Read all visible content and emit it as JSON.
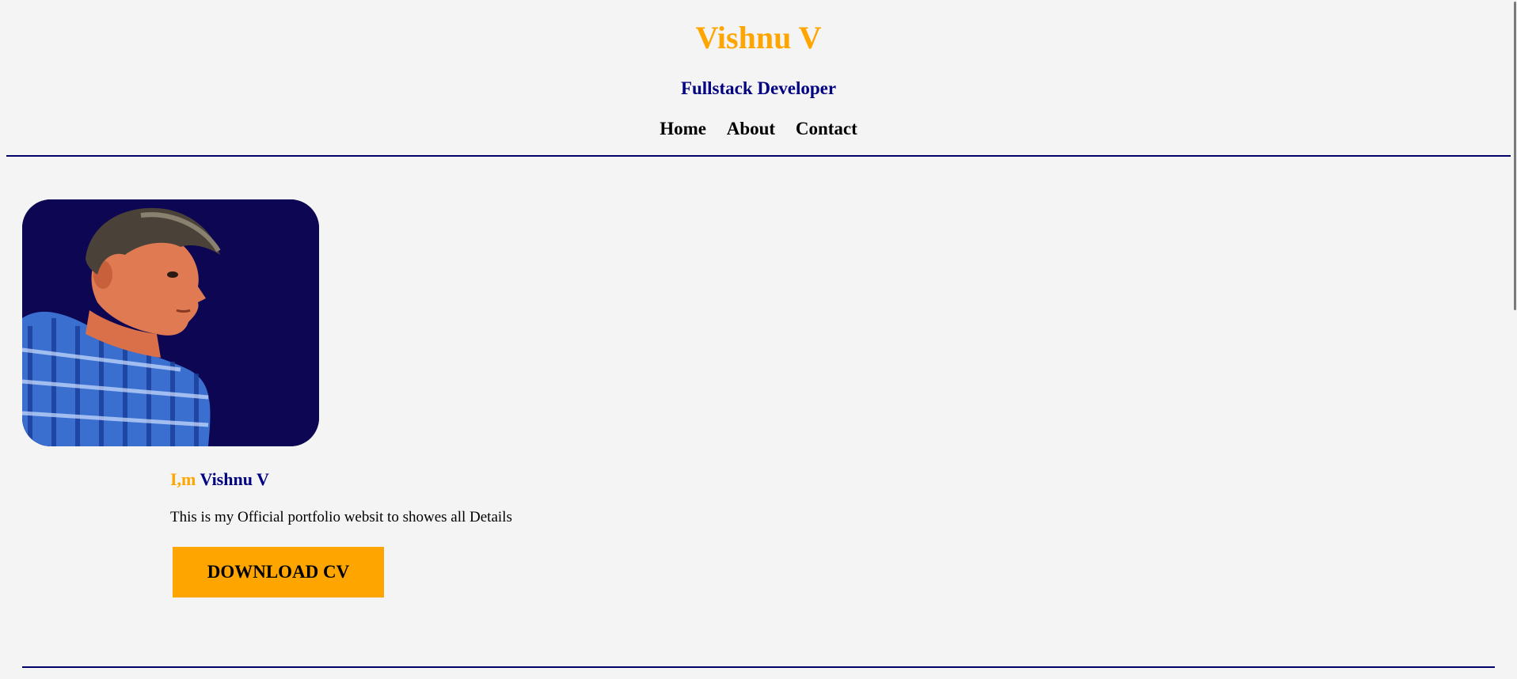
{
  "header": {
    "title": "Vishnu V",
    "subtitle": "Fullstack Developer"
  },
  "nav": {
    "items": [
      {
        "label": "Home"
      },
      {
        "label": "About"
      },
      {
        "label": "Contact"
      }
    ]
  },
  "hero": {
    "photo_icon": "profile-photo",
    "intro_prefix": "I,m",
    "intro_name": "Vishnu V",
    "description": "This is my Official portfolio websit to showes all Details",
    "button_label": "DOWNLOAD CV"
  },
  "colors": {
    "accent": "#ffa500",
    "primary": "#000080",
    "background": "#f4f4f4",
    "photo_background": "#0d0652"
  }
}
